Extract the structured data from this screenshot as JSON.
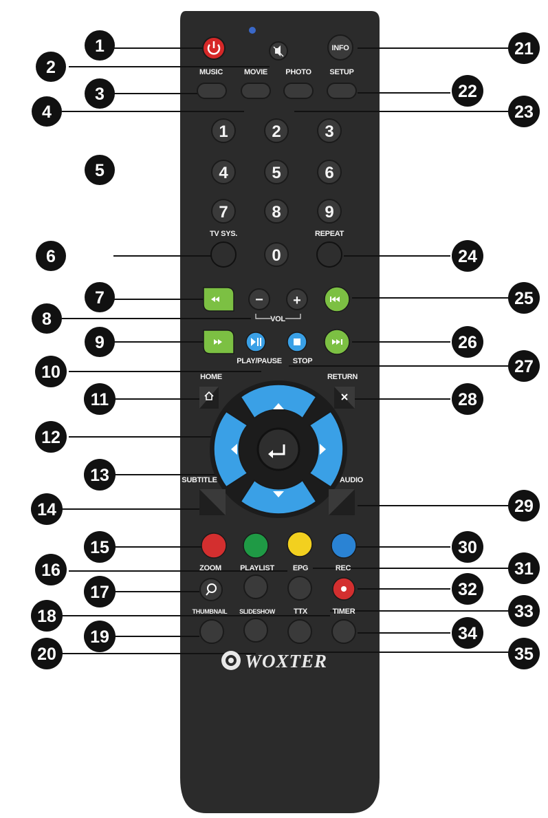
{
  "remote": {
    "brand": "WOXTER",
    "labels": {
      "music": "MUSIC",
      "movie": "MOVIE",
      "photo": "PHOTO",
      "setup": "SETUP",
      "info": "INFO",
      "tv_sys": "TV SYS.",
      "repeat": "REPEAT",
      "vol": "VOL",
      "play_pause": "PLAY/PAUSE",
      "stop": "STOP",
      "home": "HOME",
      "return": "RETURN",
      "subtitle": "SUBTITLE",
      "audio": "AUDIO",
      "zoom": "ZOOM",
      "playlist": "PLAYLIST",
      "epg": "EPG",
      "rec": "REC",
      "thumbnail": "THUMBNAIL",
      "slideshow": "SLIDESHOW",
      "ttx": "TTX",
      "timer": "TIMER",
      "vol_minus": "−",
      "vol_plus": "+"
    },
    "digits": [
      "1",
      "2",
      "3",
      "4",
      "5",
      "6",
      "7",
      "8",
      "9",
      "0"
    ]
  },
  "callouts": [
    "1",
    "2",
    "3",
    "4",
    "5",
    "6",
    "7",
    "8",
    "9",
    "10",
    "11",
    "12",
    "13",
    "14",
    "15",
    "16",
    "17",
    "18",
    "19",
    "20",
    "21",
    "22",
    "23",
    "24",
    "25",
    "26",
    "27",
    "28",
    "29",
    "30",
    "31",
    "32",
    "33",
    "34",
    "35"
  ],
  "colors": {
    "body": "#2b2b2b",
    "power": "#d62828",
    "green": "#7cc043",
    "blue": "#3aa0e6",
    "red": "#d32f2f",
    "green_key": "#1f9a45",
    "yellow": "#f2d01f",
    "blue_key": "#2a83d4"
  }
}
